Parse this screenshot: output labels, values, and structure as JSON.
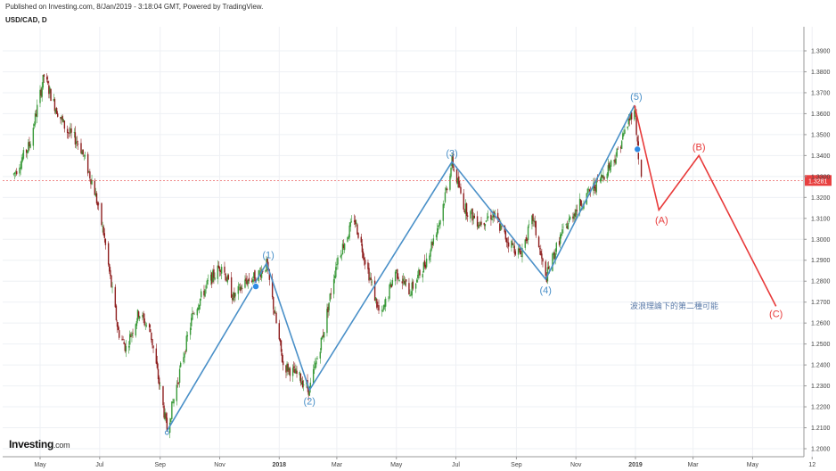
{
  "header": {
    "published": "Published on Investing.com, 8/Jan/2019 - 3:18:04 GMT, Powered by TradingView.",
    "symbol": "USD/CAD, D"
  },
  "logo": {
    "main": "Investing",
    "suffix": ".com"
  },
  "chart_data": {
    "type": "candlestick",
    "x_tick_labels": [
      "May",
      "Jul",
      "Sep",
      "Nov",
      "2018",
      "Mar",
      "May",
      "Jul",
      "Sep",
      "Nov",
      "2019",
      "Mar",
      "May",
      "12"
    ],
    "y_tick_labels": [
      "1.3900",
      "1.3800",
      "1.3700",
      "1.3600",
      "1.3500",
      "1.3400",
      "1.3300",
      "1.3200",
      "1.3100",
      "1.3000",
      "1.2900",
      "1.2800",
      "1.2700",
      "1.2600",
      "1.2500",
      "1.2400",
      "1.2300",
      "1.2200",
      "1.2100",
      "1.2000"
    ],
    "ylim": [
      1.2,
      1.395
    ],
    "current_price": "1.3281",
    "current_price_value": 1.3281,
    "colors": {
      "up": "#3a9a3a",
      "down": "#8e1e1e",
      "wave_blue": "#4a90c8",
      "wave_red": "#e83a3a",
      "price_line": "#e84040",
      "price_box": "#e84040"
    },
    "wave_points_blue": [
      {
        "label": "",
        "date": "2017-09-08",
        "price": 1.2085
      },
      {
        "label": "(1)",
        "date": "2017-12-19",
        "price": 1.2885
      },
      {
        "label": "(2)",
        "date": "2018-02-01",
        "price": 1.228
      },
      {
        "label": "(3)",
        "date": "2018-06-27",
        "price": 1.337
      },
      {
        "label": "(4)",
        "date": "2018-10-01",
        "price": 1.281
      },
      {
        "label": "(5)",
        "date": "2018-12-31",
        "price": 1.364
      }
    ],
    "wave_points_red": [
      {
        "label": "",
        "date": "2018-12-31",
        "price": 1.364
      },
      {
        "label": "(A)",
        "date": "2019-01-25",
        "price": 1.314
      },
      {
        "label": "(B)",
        "date": "2019-03-07",
        "price": 1.34
      },
      {
        "label": "(C)",
        "date": "2019-05-25",
        "price": 1.268
      }
    ],
    "annotation": "波浪理論下的第二種可能"
  }
}
